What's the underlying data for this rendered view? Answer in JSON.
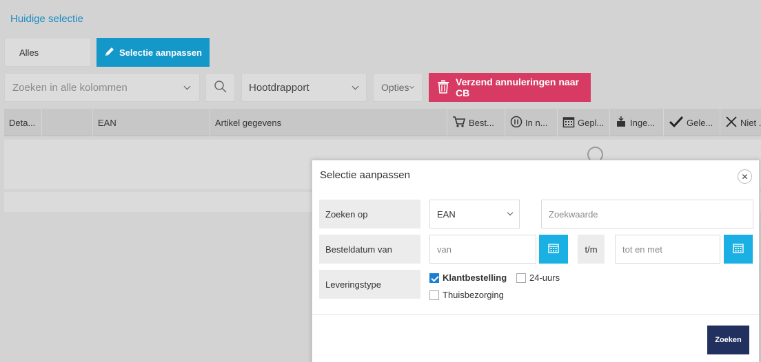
{
  "header": {
    "title": "Huidige selectie"
  },
  "selection": {
    "value": "Alles",
    "edit_label": "Selectie aanpassen"
  },
  "toolbar": {
    "search_placeholder": "Zoeken in alle kolommen",
    "report_value": "Hootdrapport",
    "options_label": "Opties",
    "cancel_label": "Verzend annuleringen naar CB"
  },
  "table": {
    "columns": [
      "Deta...",
      "EAN",
      "Artikel gegevens",
      "Best...",
      "In n...",
      "Gepl...",
      "Inge...",
      "Gele...",
      "Niet ..."
    ]
  },
  "modal": {
    "title": "Selectie aanpassen",
    "search_on_label": "Zoeken op",
    "search_on_value": "EAN",
    "search_value_placeholder": "Zoekwaarde",
    "date_label": "Besteldatum van",
    "date_from_placeholder": "van",
    "date_sep": "t/m",
    "date_to_placeholder": "tot en met",
    "delivery_label": "Leveringstype",
    "options": [
      {
        "label": "Klantbestelling",
        "checked": true
      },
      {
        "label": "24-uurs",
        "checked": false
      },
      {
        "label": "Thuisbezorging",
        "checked": false
      }
    ],
    "submit_label": "Zoeken"
  }
}
